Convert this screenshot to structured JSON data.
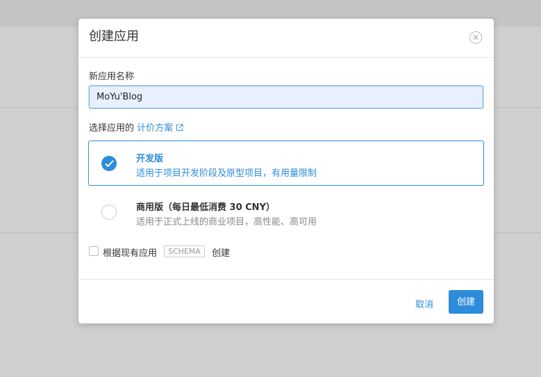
{
  "dialog": {
    "title": "创建应用",
    "close_icon": "close-icon"
  },
  "name_field": {
    "label": "新应用名称",
    "value": "MoYu'Blog"
  },
  "plan_section": {
    "prefix": "选择应用的 ",
    "link_label": "计价方案",
    "link_icon": "external-link-icon",
    "plans": [
      {
        "name": "开发版",
        "description": "适用于项目开发阶段及原型项目，有用量限制",
        "selected": true
      },
      {
        "name": "商用版（每日最低消费 30 CNY）",
        "description": "适用于正式上线的商业项目，高性能、高可用",
        "selected": false
      }
    ]
  },
  "schema_option": {
    "text_before": "根据现有应用",
    "tag": "SCHEMA",
    "text_after": "创建",
    "checked": false
  },
  "footer": {
    "cancel_label": "取消",
    "create_label": "创建"
  },
  "colors": {
    "accent": "#2d8cdb",
    "overlay": "#cfcfcf"
  }
}
